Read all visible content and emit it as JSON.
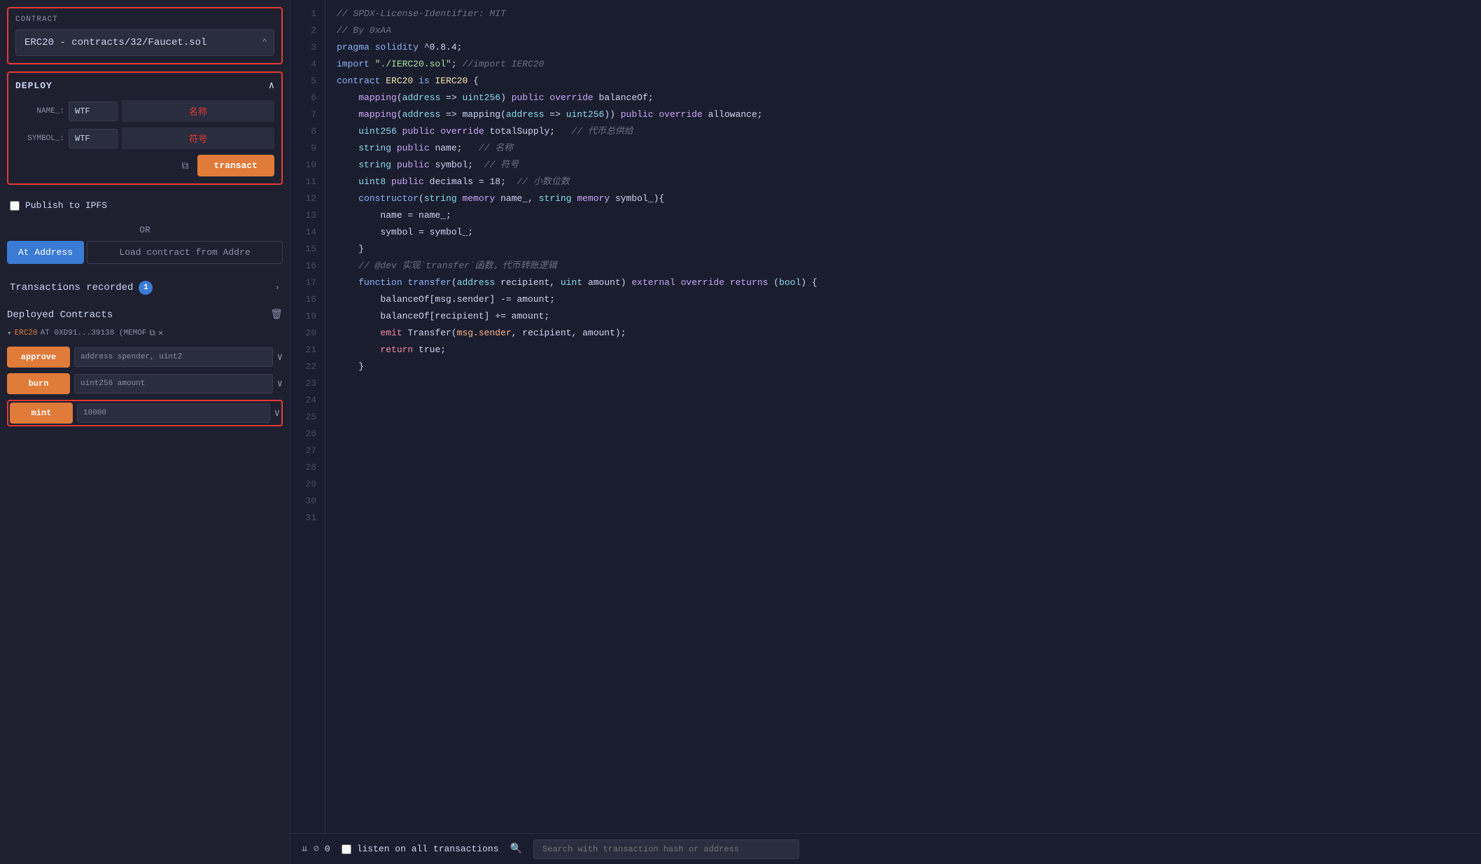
{
  "sidebar": {
    "contract_label": "CONTRACT",
    "contract_value": "ERC20 - contracts/32/Faucet.sol",
    "deploy": {
      "title": "DEPLOY",
      "name_label": "NAME_:",
      "name_value": "WTF",
      "name_placeholder": "名称",
      "symbol_label": "SYMBOL_:",
      "symbol_value": "WTF",
      "symbol_placeholder": "符号",
      "transact_label": "transact"
    },
    "ipfs_label": "Publish to IPFS",
    "or_label": "OR",
    "at_address_label": "At Address",
    "load_contract_label": "Load contract from Addre",
    "transactions_title": "Transactions recorded",
    "transactions_count": "1",
    "deployed_title": "Deployed Contracts",
    "deployed_contract": "ERC20 AT 0XD91...39138 (MEMOF",
    "methods": [
      {
        "name": "approve",
        "param": "address spender, uint2"
      },
      {
        "name": "burn",
        "param": "uint256 amount"
      },
      {
        "name": "mint",
        "param": "10000"
      }
    ]
  },
  "editor": {
    "lines": [
      {
        "num": "1",
        "tokens": [
          {
            "t": "// SPDX-License-Identifier: MIT",
            "c": "cmt"
          }
        ]
      },
      {
        "num": "2",
        "tokens": [
          {
            "t": "// By 0xAA",
            "c": "cmt"
          }
        ]
      },
      {
        "num": "3",
        "tokens": [
          {
            "t": "pragma ",
            "c": "kw"
          },
          {
            "t": "solidity",
            "c": "kw"
          },
          {
            "t": " ^0.8.4;",
            "c": "plain"
          }
        ]
      },
      {
        "num": "4",
        "tokens": [
          {
            "t": "",
            "c": "plain"
          }
        ]
      },
      {
        "num": "5",
        "tokens": [
          {
            "t": "import ",
            "c": "kw"
          },
          {
            "t": "\"./IERC20.sol\"",
            "c": "str"
          },
          {
            "t": "; ",
            "c": "plain"
          },
          {
            "t": "//import IERC20",
            "c": "cmt"
          }
        ]
      },
      {
        "num": "6",
        "tokens": [
          {
            "t": "",
            "c": "plain"
          }
        ]
      },
      {
        "num": "7",
        "tokens": [
          {
            "t": "contract ",
            "c": "kw"
          },
          {
            "t": "ERC20",
            "c": "contract-name"
          },
          {
            "t": " is ",
            "c": "kw"
          },
          {
            "t": "IERC20",
            "c": "contract-name"
          },
          {
            "t": " {",
            "c": "plain"
          }
        ]
      },
      {
        "num": "8",
        "tokens": [
          {
            "t": "",
            "c": "plain"
          }
        ]
      },
      {
        "num": "9",
        "tokens": [
          {
            "t": "    mapping",
            "c": "kw2"
          },
          {
            "t": "(",
            "c": "plain"
          },
          {
            "t": "address",
            "c": "type"
          },
          {
            "t": " => ",
            "c": "plain"
          },
          {
            "t": "uint256",
            "c": "type"
          },
          {
            "t": ") ",
            "c": "plain"
          },
          {
            "t": "public",
            "c": "kw2"
          },
          {
            "t": " ",
            "c": "plain"
          },
          {
            "t": "override",
            "c": "kw2"
          },
          {
            "t": " balanceOf;",
            "c": "plain"
          }
        ]
      },
      {
        "num": "10",
        "tokens": [
          {
            "t": "",
            "c": "plain"
          }
        ]
      },
      {
        "num": "11",
        "tokens": [
          {
            "t": "    mapping",
            "c": "kw2"
          },
          {
            "t": "(",
            "c": "plain"
          },
          {
            "t": "address",
            "c": "type"
          },
          {
            "t": " => mapping(",
            "c": "plain"
          },
          {
            "t": "address",
            "c": "type"
          },
          {
            "t": " => ",
            "c": "plain"
          },
          {
            "t": "uint256",
            "c": "type"
          },
          {
            "t": ")) ",
            "c": "plain"
          },
          {
            "t": "public",
            "c": "kw2"
          },
          {
            "t": " ",
            "c": "plain"
          },
          {
            "t": "override",
            "c": "kw2"
          },
          {
            "t": " allowance;",
            "c": "plain"
          }
        ]
      },
      {
        "num": "12",
        "tokens": [
          {
            "t": "",
            "c": "plain"
          }
        ]
      },
      {
        "num": "13",
        "tokens": [
          {
            "t": "    ",
            "c": "plain"
          },
          {
            "t": "uint256",
            "c": "type"
          },
          {
            "t": " ",
            "c": "plain"
          },
          {
            "t": "public",
            "c": "kw2"
          },
          {
            "t": " ",
            "c": "plain"
          },
          {
            "t": "override",
            "c": "kw2"
          },
          {
            "t": " totalSupply;   ",
            "c": "plain"
          },
          {
            "t": "// 代币总供给",
            "c": "cmt"
          }
        ]
      },
      {
        "num": "14",
        "tokens": [
          {
            "t": "",
            "c": "plain"
          }
        ]
      },
      {
        "num": "15",
        "tokens": [
          {
            "t": "    ",
            "c": "plain"
          },
          {
            "t": "string",
            "c": "type"
          },
          {
            "t": " ",
            "c": "plain"
          },
          {
            "t": "public",
            "c": "kw2"
          },
          {
            "t": " name;   ",
            "c": "plain"
          },
          {
            "t": "// 名称",
            "c": "cmt"
          }
        ]
      },
      {
        "num": "16",
        "tokens": [
          {
            "t": "    ",
            "c": "plain"
          },
          {
            "t": "string",
            "c": "type"
          },
          {
            "t": " ",
            "c": "plain"
          },
          {
            "t": "public",
            "c": "kw2"
          },
          {
            "t": " symbol;  ",
            "c": "plain"
          },
          {
            "t": "// 符号",
            "c": "cmt"
          }
        ]
      },
      {
        "num": "17",
        "tokens": [
          {
            "t": "",
            "c": "plain"
          }
        ]
      },
      {
        "num": "18",
        "tokens": [
          {
            "t": "    ",
            "c": "plain"
          },
          {
            "t": "uint8",
            "c": "type"
          },
          {
            "t": " ",
            "c": "plain"
          },
          {
            "t": "public",
            "c": "kw2"
          },
          {
            "t": " decimals = 18;  ",
            "c": "plain"
          },
          {
            "t": "// 小数位数",
            "c": "cmt"
          }
        ]
      },
      {
        "num": "19",
        "tokens": [
          {
            "t": "",
            "c": "plain"
          }
        ]
      },
      {
        "num": "20",
        "tokens": [
          {
            "t": "    ",
            "c": "plain"
          },
          {
            "t": "constructor",
            "c": "fn"
          },
          {
            "t": "(",
            "c": "plain"
          },
          {
            "t": "string",
            "c": "type"
          },
          {
            "t": " ",
            "c": "plain"
          },
          {
            "t": "memory",
            "c": "kw2"
          },
          {
            "t": " name_, ",
            "c": "plain"
          },
          {
            "t": "string",
            "c": "type"
          },
          {
            "t": " ",
            "c": "plain"
          },
          {
            "t": "memory",
            "c": "kw2"
          },
          {
            "t": " symbol_){",
            "c": "plain"
          }
        ]
      },
      {
        "num": "21",
        "tokens": [
          {
            "t": "        name = name_;",
            "c": "plain"
          }
        ]
      },
      {
        "num": "22",
        "tokens": [
          {
            "t": "        symbol = symbol_;",
            "c": "plain"
          }
        ]
      },
      {
        "num": "23",
        "tokens": [
          {
            "t": "    }",
            "c": "plain"
          }
        ]
      },
      {
        "num": "24",
        "tokens": [
          {
            "t": "",
            "c": "plain"
          }
        ]
      },
      {
        "num": "25",
        "tokens": [
          {
            "t": "    ",
            "c": "plain"
          },
          {
            "t": "// @dev 实现`transfer`函数，代币转账逻辑",
            "c": "cmt"
          }
        ]
      },
      {
        "num": "26",
        "tokens": [
          {
            "t": "    ",
            "c": "plain"
          },
          {
            "t": "function",
            "c": "kw"
          },
          {
            "t": " ",
            "c": "plain"
          },
          {
            "t": "transfer",
            "c": "fn"
          },
          {
            "t": "(",
            "c": "plain"
          },
          {
            "t": "address",
            "c": "type"
          },
          {
            "t": " recipient, ",
            "c": "plain"
          },
          {
            "t": "uint",
            "c": "type"
          },
          {
            "t": " amount) ",
            "c": "plain"
          },
          {
            "t": "external",
            "c": "kw2"
          },
          {
            "t": " ",
            "c": "plain"
          },
          {
            "t": "override",
            "c": "kw2"
          },
          {
            "t": " ",
            "c": "plain"
          },
          {
            "t": "returns",
            "c": "kw2"
          },
          {
            "t": " (",
            "c": "plain"
          },
          {
            "t": "bool",
            "c": "type"
          },
          {
            "t": ") {",
            "c": "plain"
          }
        ]
      },
      {
        "num": "27",
        "tokens": [
          {
            "t": "        balanceOf[msg.sender] -= amount;",
            "c": "plain"
          }
        ]
      },
      {
        "num": "28",
        "tokens": [
          {
            "t": "        balanceOf[recipient] += amount;",
            "c": "plain"
          }
        ]
      },
      {
        "num": "29",
        "tokens": [
          {
            "t": "        ",
            "c": "plain"
          },
          {
            "t": "emit",
            "c": "red-kw"
          },
          {
            "t": " Transfer(",
            "c": "plain"
          },
          {
            "t": "msg.sender",
            "c": "orange"
          },
          {
            "t": ", recipient, amount);",
            "c": "plain"
          }
        ]
      },
      {
        "num": "30",
        "tokens": [
          {
            "t": "        ",
            "c": "plain"
          },
          {
            "t": "return",
            "c": "red-kw"
          },
          {
            "t": " true;",
            "c": "plain"
          }
        ]
      },
      {
        "num": "31",
        "tokens": [
          {
            "t": "    }",
            "c": "plain"
          }
        ]
      }
    ]
  },
  "bottom": {
    "listen_label": "listen on all transactions",
    "search_placeholder": "Search with transaction hash or address",
    "count": "0"
  }
}
